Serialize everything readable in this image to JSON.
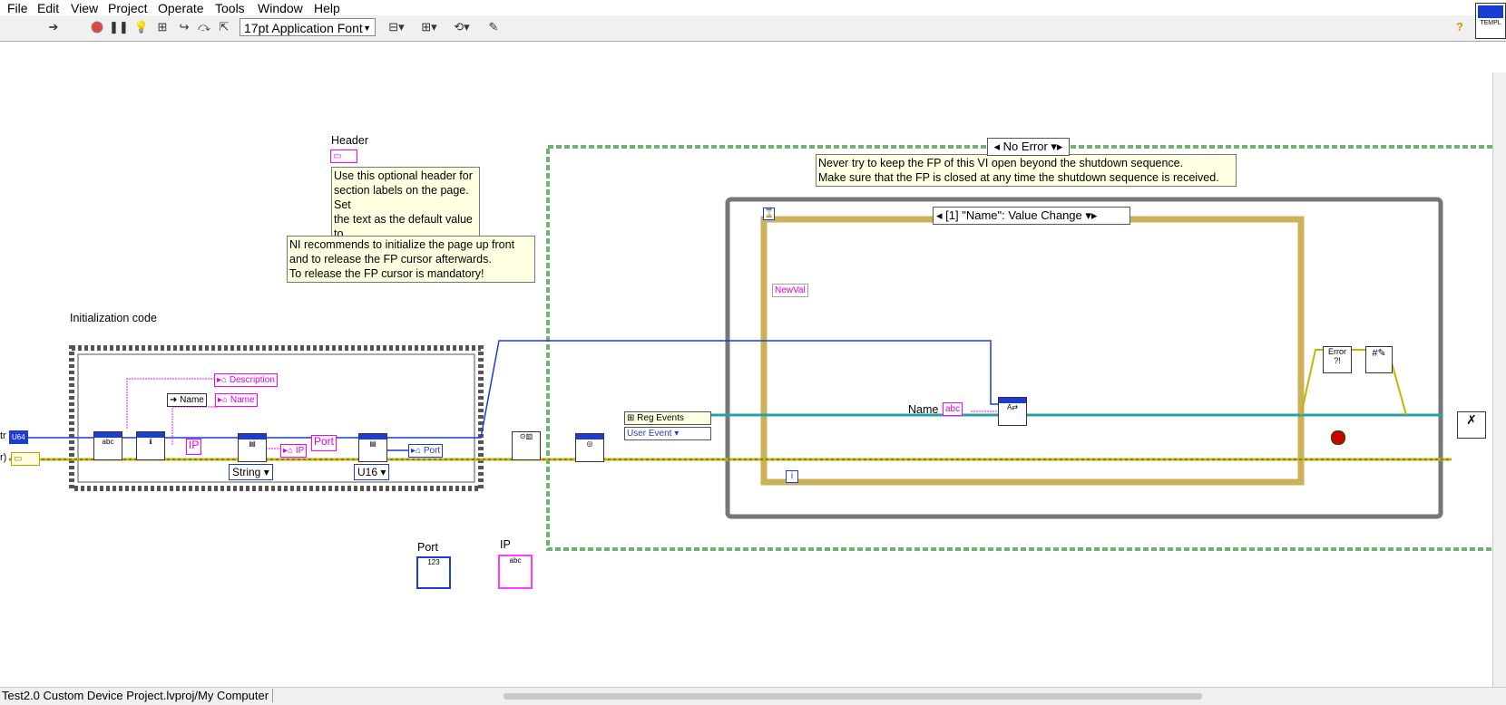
{
  "menu": [
    "File",
    "Edit",
    "View",
    "Project",
    "Operate",
    "Tools",
    "Window",
    "Help"
  ],
  "toolbar": {
    "font_label": "17pt Application Font",
    "help_icon": "?"
  },
  "templ_label": "TEMPL",
  "labels": {
    "header": "Header",
    "init": "Initialization code",
    "port_ctrl": "Port",
    "ip_ctrl": "IP",
    "name": "Name",
    "no_error": "No Error",
    "event_case": "[1] \"Name\": Value Change",
    "newval": "NewVal",
    "description": "Description",
    "name_ref": "Name",
    "name_prop": "Name",
    "ip_tag": "IP",
    "ip_prop": "IP",
    "port_tag": "Port",
    "port_prop": "Port",
    "string": "String",
    "u16": "U16",
    "reg_events": "Reg Events",
    "user_event": "User Event",
    "tr": "tr",
    "r": "r)",
    "u64": "U64",
    "iter": "i",
    "error": "Error"
  },
  "notes": {
    "header_note": [
      "Use this optional header for",
      "section labels on the page. Set",
      "the text as the default value to"
    ],
    "ni_note": [
      "NI recommends to initialize the page up front",
      "and to release the FP cursor afterwards.",
      "To release the FP cursor is mandatory!"
    ],
    "shutdown_note": [
      "Never try to keep the FP of this VI open beyond the shutdown sequence.",
      "Make sure that the FP is closed at any time the shutdown sequence is received."
    ]
  },
  "status": {
    "path": "Test2.0 Custom Device Project.lvproj/My Computer"
  },
  "colors": {
    "wire_error": "#c8b400",
    "wire_ref": "#1c3cd6",
    "wire_string": "#ff3cff",
    "struct_green": "#6fb56f",
    "event_border": "#c9b25a",
    "while_gray": "#777777"
  }
}
